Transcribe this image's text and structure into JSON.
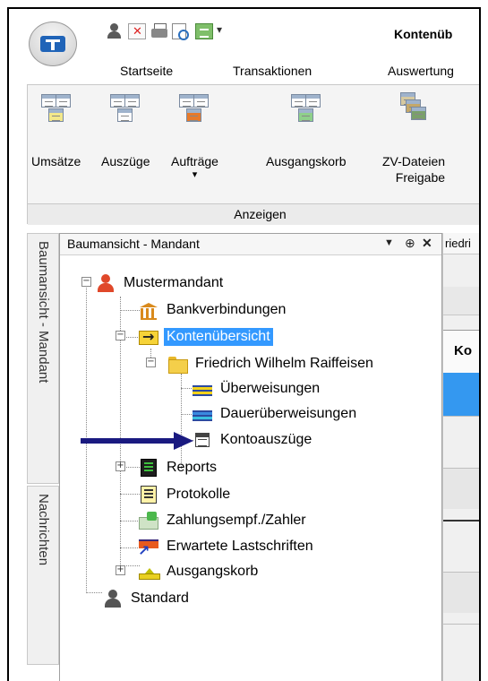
{
  "titlebar": {
    "title": "Kontenüb",
    "quick_access_icons": [
      "user-icon",
      "close-x-icon",
      "print-icon",
      "preview-icon",
      "export-icon"
    ],
    "dropdown_glyph": "▾"
  },
  "ribbon_tabs": [
    "Startseite",
    "Transaktionen",
    "Auswertung"
  ],
  "ribbon": {
    "buttons": [
      {
        "label": "Umsätze"
      },
      {
        "label": "Auszüge"
      },
      {
        "label": "Aufträge",
        "dropdown": "▾"
      },
      {
        "label": "Ausgangskorb"
      },
      {
        "label": "ZV-Dateien",
        "label2": "Freigabe"
      }
    ],
    "group_label": "Anzeigen"
  },
  "side_tabs": [
    "Baumansicht - Mandant",
    "Nachrichten"
  ],
  "pane": {
    "title": "Baumansicht - Mandant",
    "menu_glyph": "▼",
    "pin_glyph": "⊕",
    "close_glyph": "✕"
  },
  "tree": {
    "collapse_glyph": "−",
    "expand_glyph": "+",
    "items": [
      {
        "label": "Mustermandant"
      },
      {
        "label": "Bankverbindungen"
      },
      {
        "label": "Kontenübersicht",
        "selected": true
      },
      {
        "label": "Friedrich Wilhelm Raiffeisen"
      },
      {
        "label": "Überweisungen"
      },
      {
        "label": "Dauerüberweisungen"
      },
      {
        "label": "Kontoauszüge"
      },
      {
        "label": "Reports"
      },
      {
        "label": "Protokolle"
      },
      {
        "label": "Zahlungsempf./Zahler"
      },
      {
        "label": "Erwartete Lastschriften"
      },
      {
        "label": "Ausgangskorb"
      },
      {
        "label": "Standard"
      }
    ]
  },
  "document": {
    "tab_label": "riedri",
    "column_header": "Ko"
  },
  "colors": {
    "selection": "#3399ff",
    "grid_selected_row": "#3498f0",
    "arrow": "#1a1a80"
  }
}
